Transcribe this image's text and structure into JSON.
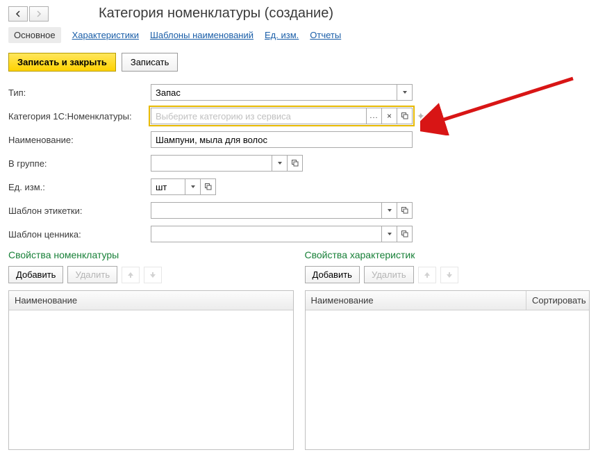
{
  "header": {
    "title": "Категория номенклатуры (создание)"
  },
  "tabs": {
    "active": "Основное",
    "items": [
      "Характеристики",
      "Шаблоны наименований",
      "Ед. изм.",
      "Отчеты"
    ]
  },
  "actions": {
    "saveClose": "Записать и закрыть",
    "save": "Записать"
  },
  "form": {
    "typeLabel": "Тип:",
    "typeValue": "Запас",
    "category1cLabel": "Категория 1С:Номенклатуры:",
    "category1cPlaceholder": "Выберите категорию из сервиса",
    "category1cValue": "",
    "nameLabel": "Наименование:",
    "nameValue": "Шампуни, мыла для волос",
    "groupLabel": "В группе:",
    "groupValue": "",
    "unitLabel": "Ед. изм.:",
    "unitValue": "шт",
    "labelTplLabel": "Шаблон этикетки:",
    "labelTplValue": "",
    "priceTplLabel": "Шаблон ценника:",
    "priceTplValue": ""
  },
  "nomProps": {
    "title": "Свойства номенклатуры",
    "add": "Добавить",
    "del": "Удалить",
    "colName": "Наименование"
  },
  "charProps": {
    "title": "Свойства характеристик",
    "add": "Добавить",
    "del": "Удалить",
    "colName": "Наименование",
    "colSort": "Сортировать"
  }
}
